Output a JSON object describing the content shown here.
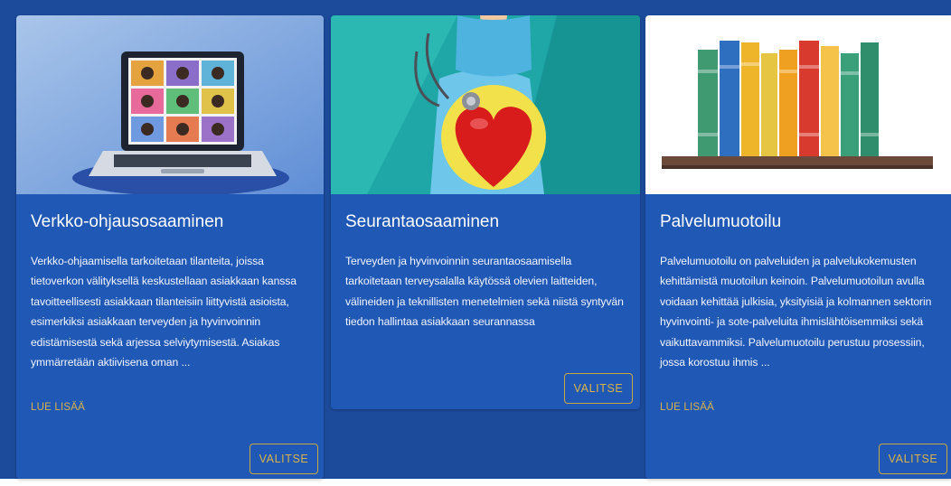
{
  "cards": [
    {
      "image_name": "video-call-laptop-image",
      "title": "Verkko-ohjausosaaminen",
      "description": "Verkko-ohjaamisella tarkoitetaan tilanteita, joissa tietoverkon välityksellä keskustellaan asiakkaan kanssa tavoitteellisesti asiakkaan tilanteisiin liittyvistä asioista, esimerkiksi asiakkaan terveyden ja hyvinvoinnin edistämisestä sekä arjessa selviytymisestä. Asiakas ymmärretään aktiivisena oman ...",
      "read_more": "LUE LISÄÄ",
      "button": "VALITSE"
    },
    {
      "image_name": "doctor-heart-stethoscope-image",
      "title": "Seurantaosaaminen",
      "description": "Terveyden ja hyvinvoinnin seurantaosaamisella tarkoitetaan terveysalalla käytössä olevien laitteiden, välineiden ja teknillisten menetelmien sekä niistä syntyvän tiedon hallintaa asiakkaan seurannassa",
      "button": "VALITSE"
    },
    {
      "image_name": "books-on-shelf-image",
      "title": "Palvelumuotoilu",
      "description": "Palvelumuotoilu on palveluiden ja palvelukokemusten kehittämistä muotoilun keinoin. Palvelumuotoilun avulla voidaan kehittää julkisia, yksityisiä ja kolmannen sektorin hyvinvointi- ja sote-palveluita ihmislähtöisemmiksi sekä vaikuttavammiksi. Palvelumuotoilu perustuu prosessiin, jossa korostuu ihmis ...",
      "read_more": "LUE LISÄÄ",
      "button": "VALITSE"
    }
  ],
  "colors": {
    "background": "#1c4b9c",
    "card": "#2058b5",
    "accent_gold": "#d9b34a",
    "text": "#ffffff"
  }
}
